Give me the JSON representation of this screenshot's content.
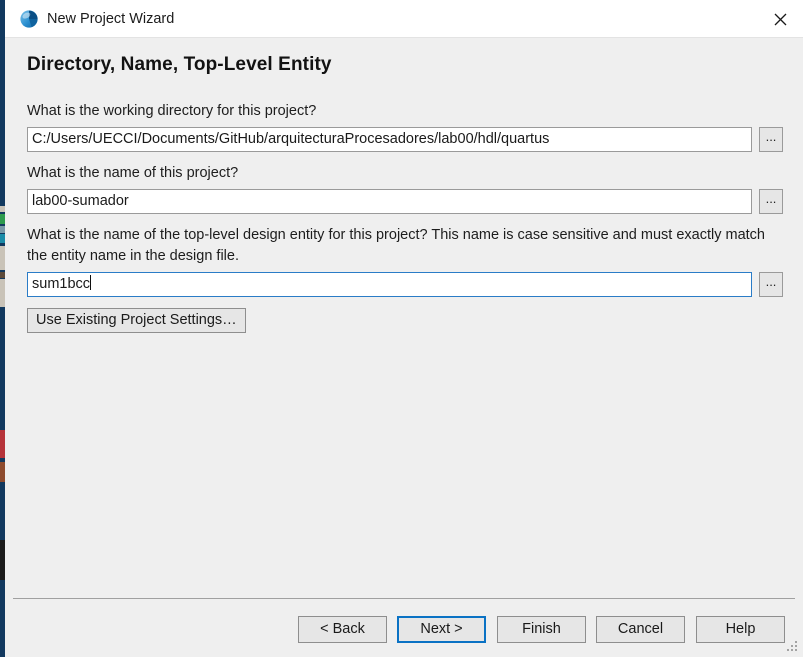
{
  "window": {
    "title": "New Project Wizard",
    "app_icon": "quartus-globe-icon",
    "close_label": "✕"
  },
  "page": {
    "heading": "Directory, Name, Top-Level Entity"
  },
  "fields": [
    {
      "label": "What is the working directory for this project?",
      "value": "C:/Users/UECCI/Documents/GitHub/arquitecturaProcesadores/lab00/hdl/quartus",
      "placeholder": "",
      "browse_label": "...",
      "focused": false
    },
    {
      "label": "What is the name of this project?",
      "value": "lab00-sumador",
      "placeholder": "",
      "browse_label": "...",
      "focused": false
    },
    {
      "label": "What is the name of the top-level design entity for this project? This name is case sensitive and must exactly match the entity name in the design file.",
      "value": "sum1bcc",
      "placeholder": "",
      "browse_label": "...",
      "focused": true
    }
  ],
  "actions": {
    "use_existing_settings": "Use Existing Project Settings…"
  },
  "footer": {
    "buttons": [
      {
        "label": "< Back",
        "default": false
      },
      {
        "label": "Next >",
        "default": true
      },
      {
        "label": "Finish",
        "default": false
      },
      {
        "label": "Cancel",
        "default": false
      },
      {
        "label": "Help",
        "default": false
      }
    ]
  },
  "colors": {
    "accent": "#0a72c4",
    "dialog_bg": "#efefef",
    "titlebar_bg": "#ffffff",
    "behind_window": "#12395f",
    "field_border": "#9a9a9a"
  }
}
